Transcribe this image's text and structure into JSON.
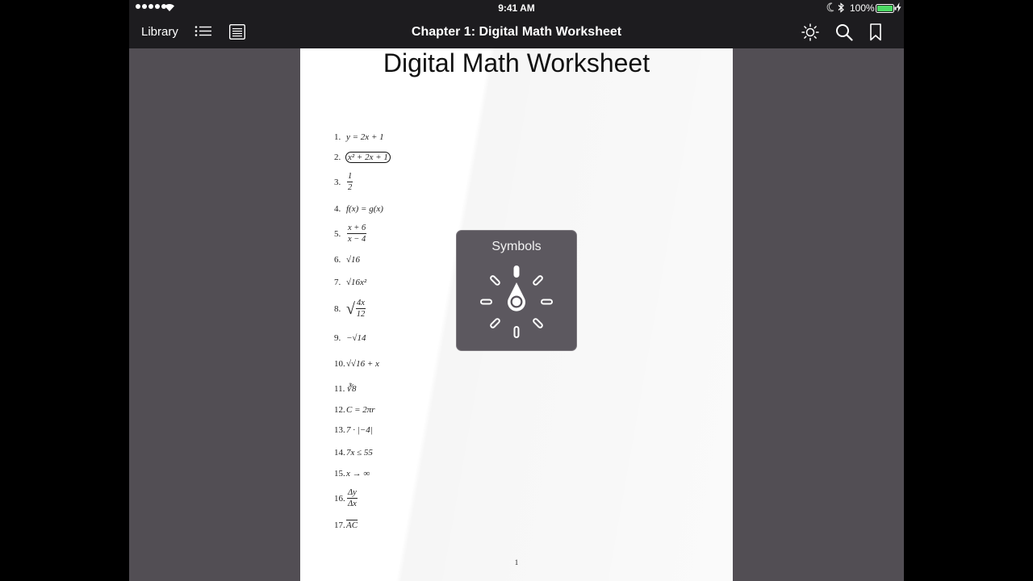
{
  "status_bar": {
    "time": "9:41 AM",
    "battery": "100%",
    "battery_color": "#4cd964"
  },
  "nav": {
    "library_label": "Library",
    "title": "Chapter 1: Digital Math Worksheet",
    "icons": [
      "list-icon",
      "notes-icon",
      "brightness-icon",
      "search-icon",
      "bookmark-icon"
    ]
  },
  "page": {
    "title": "Digital Math Worksheet",
    "page_number": "1",
    "problems": [
      {
        "n": "1.",
        "expr": "y = 2x + 1"
      },
      {
        "n": "2.",
        "expr": "x² + 2x + 1",
        "selected": true
      },
      {
        "n": "3.",
        "num": "1",
        "den": "2"
      },
      {
        "n": "4.",
        "expr": "f(x) = g(x)"
      },
      {
        "n": "5.",
        "num": "x + 6",
        "den": "x − 4"
      },
      {
        "n": "6.",
        "expr": "√16"
      },
      {
        "n": "7.",
        "expr": "√16x²"
      },
      {
        "n": "8.",
        "num": "4x",
        "den": "12",
        "radical": true
      },
      {
        "n": "9.",
        "expr": "−√14"
      },
      {
        "n": "10.",
        "expr": "√√16 + x"
      },
      {
        "n": "11.",
        "expr": "∛8"
      },
      {
        "n": "12.",
        "expr": "C = 2πr"
      },
      {
        "n": "13.",
        "expr": "7 · |−4|"
      },
      {
        "n": "14.",
        "expr": "7x ≤ 55"
      },
      {
        "n": "15.",
        "expr": "x → ∞"
      },
      {
        "n": "16.",
        "num": "Δy",
        "den": "Δx"
      },
      {
        "n": "17.",
        "expr": "AC"
      }
    ]
  },
  "symbols_hud": {
    "title": "Symbols",
    "icon": "rotor-icon"
  }
}
